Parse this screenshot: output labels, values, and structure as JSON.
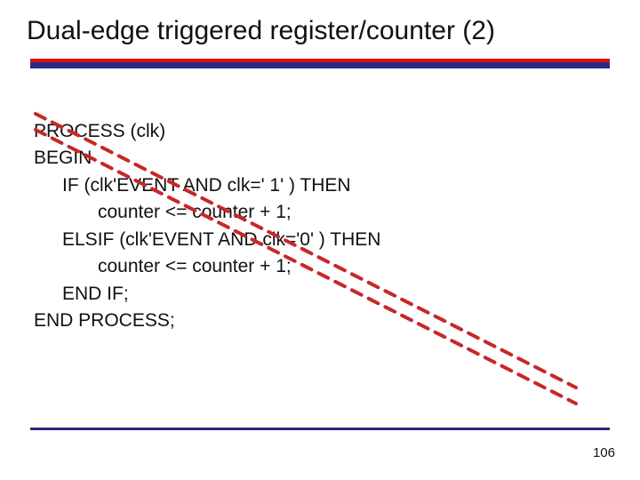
{
  "title": "Dual-edge triggered register/counter (2)",
  "code": {
    "l1": "PROCESS (clk)",
    "l2": "BEGIN",
    "l3": "IF (clk'EVENT AND clk=' 1' ) THEN",
    "l4": "counter <= counter + 1;",
    "l5": "ELSIF (clk'EVENT AND clk='0' ) THEN",
    "l6": "counter <= counter + 1;",
    "l7": "END IF;",
    "l8": "END PROCESS;"
  },
  "page": "106",
  "strike": {
    "color": "#c62828",
    "dash": "12,9",
    "width": 4
  }
}
